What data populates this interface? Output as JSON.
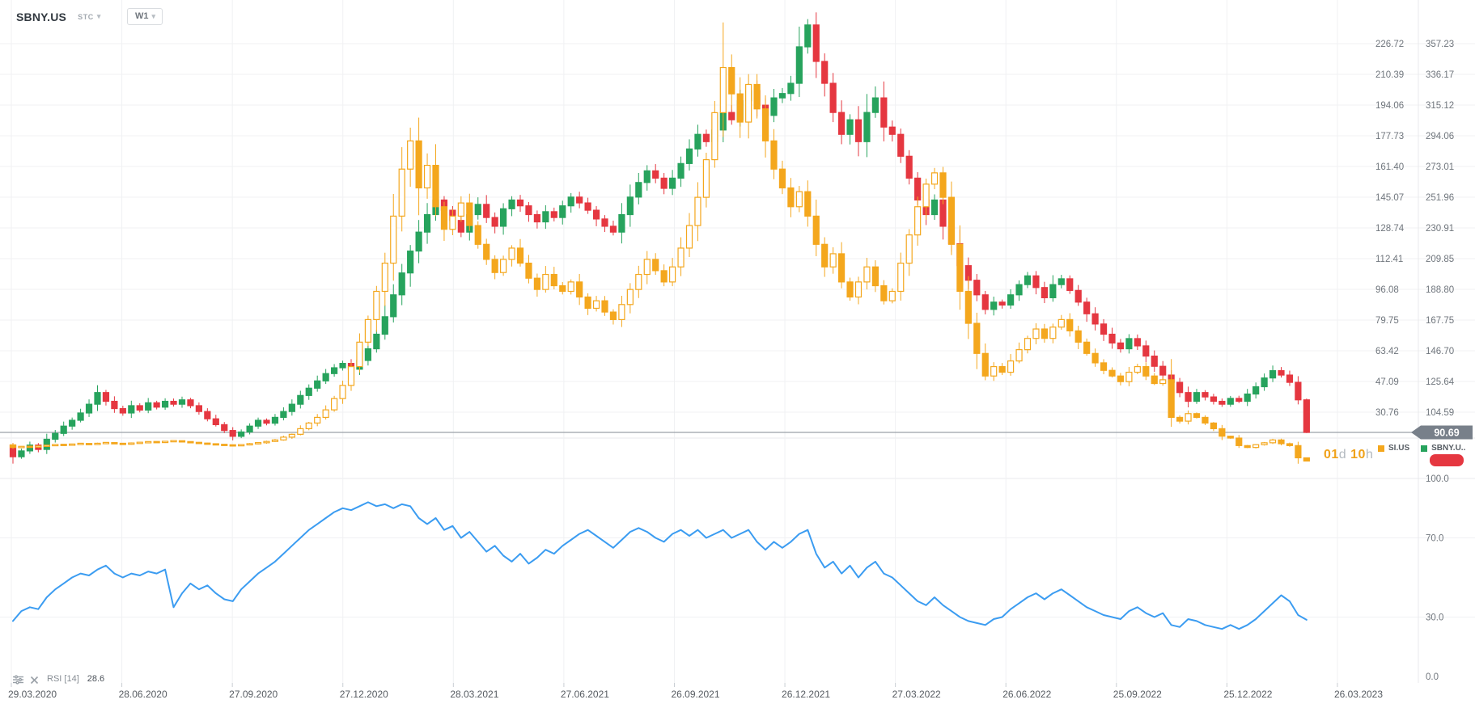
{
  "header": {
    "symbol": "SBNY.US",
    "exchange": "STC",
    "timeframe": "W1"
  },
  "price_line": {
    "tag_value": "90.69",
    "tag_color": "#78808a"
  },
  "countdown": {
    "days": "01",
    "days_unit": "d",
    "hours": "10",
    "hours_unit": "h"
  },
  "legend": {
    "si": {
      "label": "SI.US",
      "color": "#f4a71d"
    },
    "sbny": {
      "label": "SBNY.U..",
      "color": "#27a35d"
    }
  },
  "indicator": {
    "name": "RSI",
    "period": "[14]",
    "value": "28.6"
  },
  "colors": {
    "up": "#27a35d",
    "down": "#e53740",
    "overlay": "#f4a71d",
    "rsi_line": "#3b9cf1",
    "grid": "#f0f1f3",
    "separator": "#e8eaec",
    "price_line": "#9aa1a8",
    "axis_text": "#70767d",
    "date_text": "#565b61",
    "badge": "#e53740"
  },
  "chart_data": {
    "type": "candlestick",
    "title": "SBNY.US weekly chart with SI.US overlay and RSI(14)",
    "timeframe": "W1",
    "start_date": "29.03.2020",
    "end_date": "26.03.2023",
    "current_price": 90.69,
    "legend_position": "right",
    "grid": true,
    "date_ticks": [
      "29.03.2020",
      "28.06.2020",
      "27.09.2020",
      "27.12.2020",
      "28.03.2021",
      "27.06.2021",
      "26.09.2021",
      "26.12.2021",
      "27.03.2022",
      "26.06.2022",
      "25.09.2022",
      "25.12.2022",
      "26.03.2023"
    ],
    "sbny_axis_ticks": [
      "357.23",
      "336.17",
      "315.12",
      "294.06",
      "273.01",
      "251.96",
      "230.91",
      "209.85",
      "188.80",
      "167.75",
      "146.70",
      "125.64",
      "104.59"
    ],
    "si_axis_ticks": [
      "226.72",
      "210.39",
      "194.06",
      "177.73",
      "161.40",
      "145.07",
      "128.74",
      "112.41",
      "96.08",
      "79.75",
      "63.42",
      "47.09",
      "30.76"
    ],
    "rsi_axis_ticks": [
      "100.0",
      "70.0",
      "30.0",
      "0.0"
    ],
    "series": [
      {
        "name": "SBNY.US",
        "pane": "price",
        "axis": "sbny",
        "style": "solid",
        "first_open": 82,
        "key_highs": {
          "94": 374
        },
        "closes": [
          74,
          78,
          82,
          79,
          86,
          90,
          95,
          99,
          104,
          110,
          118,
          112,
          107,
          104,
          109,
          106,
          111,
          108,
          112,
          110,
          113,
          109,
          105,
          100,
          96,
          92,
          88,
          91,
          95,
          99,
          97,
          101,
          105,
          110,
          116,
          121,
          126,
          131,
          135,
          138,
          134,
          140,
          148,
          158,
          170,
          185,
          200,
          215,
          228,
          240,
          250,
          243,
          236,
          228,
          240,
          247,
          238,
          232,
          244,
          250,
          246,
          240,
          235,
          242,
          238,
          246,
          252,
          248,
          243,
          237,
          232,
          228,
          240,
          252,
          262,
          270,
          265,
          258,
          265,
          275,
          285,
          295,
          290,
          298,
          310,
          305,
          318,
          325,
          315,
          308,
          320,
          323,
          330,
          355,
          370,
          345,
          330,
          310,
          295,
          305,
          290,
          310,
          320,
          300,
          295,
          280,
          265,
          250,
          240,
          250,
          232,
          220,
          205,
          195,
          185,
          175,
          180,
          178,
          185,
          192,
          198,
          190,
          183,
          192,
          196,
          188,
          180,
          172,
          165,
          158,
          152,
          148,
          155,
          150,
          143,
          136,
          130,
          125,
          118,
          112,
          118,
          115,
          112,
          110,
          114,
          112,
          117,
          122,
          128,
          133,
          130,
          125,
          113,
          90.69
        ]
      },
      {
        "name": "SI.US",
        "pane": "price",
        "axis": "si",
        "style": "hollow-up",
        "first_open": 13.4,
        "key_highs": {
          "84": 238
        },
        "closes": [
          12,
          12.5,
          12.2,
          12.8,
          13,
          13.5,
          13.2,
          13.8,
          14,
          13.6,
          14.2,
          14.5,
          14,
          13.8,
          14.3,
          14.6,
          15,
          14.7,
          15.2,
          15.5,
          15,
          14.6,
          14.2,
          13.8,
          13.5,
          13.2,
          13,
          13.4,
          14,
          14.5,
          15.2,
          16,
          17.5,
          19,
          22,
          25,
          28,
          32,
          38,
          45,
          55,
          68,
          80,
          95,
          110,
          135,
          160,
          175,
          150,
          162,
          140,
          128,
          135,
          142,
          130,
          120,
          112,
          105,
          112,
          118,
          110,
          102,
          96,
          104,
          98,
          95,
          100,
          92,
          86,
          90,
          84,
          80,
          88,
          96,
          104,
          112,
          106,
          100,
          108,
          118,
          130,
          145,
          165,
          190,
          214,
          200,
          185,
          205,
          192,
          175,
          160,
          150,
          140,
          148,
          135,
          120,
          108,
          115,
          100,
          92,
          100,
          108,
          98,
          90,
          95,
          110,
          125,
          140,
          152,
          158,
          145,
          120,
          95,
          78,
          62,
          50,
          55,
          52,
          58,
          64,
          70,
          75,
          70,
          76,
          80,
          74,
          68,
          62,
          57,
          53,
          50,
          47,
          52,
          55,
          50,
          46,
          48,
          28,
          26,
          30,
          28,
          25,
          22,
          18,
          17,
          13,
          12,
          13.5,
          14.5,
          16,
          14,
          13,
          6.5,
          4.8
        ]
      },
      {
        "name": "RSI",
        "pane": "rsi",
        "type": "line",
        "last_value": 28.6,
        "values": [
          28,
          33,
          35,
          34,
          40,
          44,
          47,
          50,
          52,
          51,
          54,
          56,
          52,
          50,
          52,
          51,
          53,
          52,
          54,
          35,
          42,
          47,
          44,
          46,
          42,
          39,
          38,
          44,
          48,
          52,
          55,
          58,
          62,
          66,
          70,
          74,
          77,
          80,
          83,
          85,
          84,
          86,
          88,
          86,
          87,
          85,
          87,
          86,
          80,
          77,
          80,
          74,
          76,
          70,
          73,
          68,
          63,
          66,
          61,
          58,
          62,
          57,
          60,
          64,
          62,
          66,
          69,
          72,
          74,
          71,
          68,
          65,
          69,
          73,
          75,
          73,
          70,
          68,
          72,
          74,
          71,
          74,
          70,
          72,
          74,
          70,
          72,
          74,
          68,
          64,
          68,
          65,
          68,
          72,
          74,
          62,
          55,
          58,
          52,
          56,
          50,
          55,
          58,
          52,
          50,
          46,
          42,
          38,
          36,
          40,
          36,
          33,
          30,
          28,
          27,
          26,
          29,
          30,
          34,
          37,
          40,
          42,
          39,
          42,
          44,
          41,
          38,
          35,
          33,
          31,
          30,
          29,
          33,
          35,
          32,
          30,
          32,
          26,
          25,
          29,
          28,
          26,
          25,
          24,
          26,
          24,
          26,
          29,
          33,
          37,
          41,
          38,
          31,
          28.6
        ]
      }
    ]
  }
}
